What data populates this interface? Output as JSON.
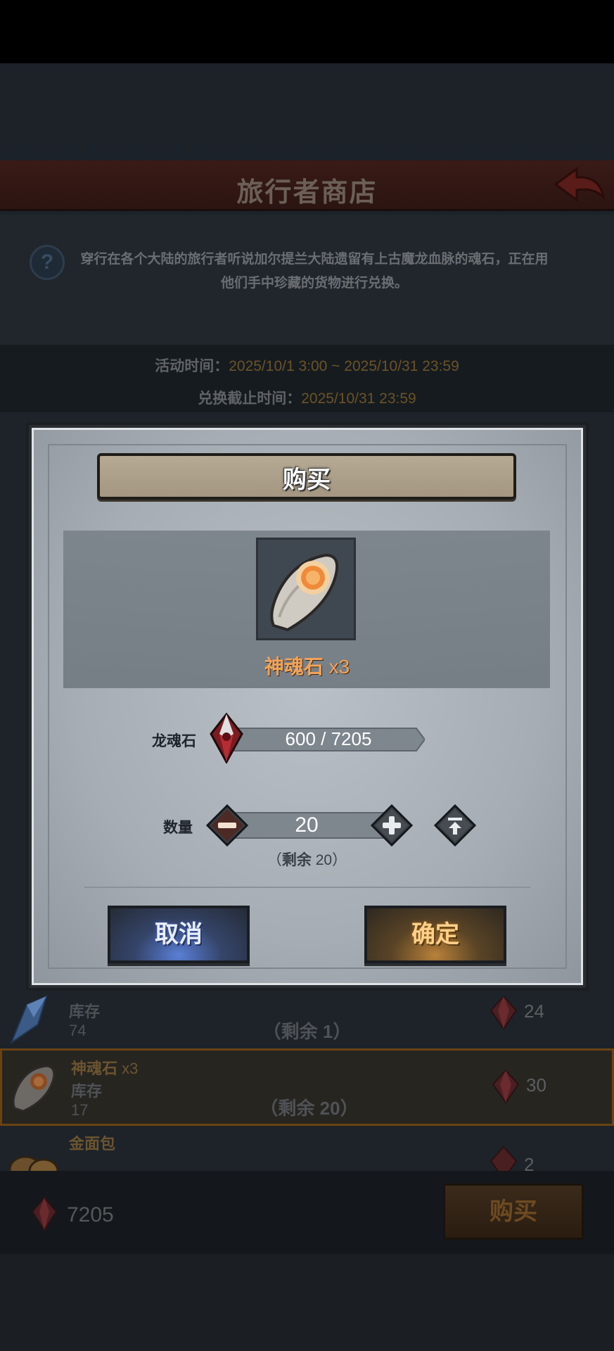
{
  "shop": {
    "title": "旅行者商店",
    "description": "穿行在各个大陆的旅行者听说加尔提兰大陆遗留有上古魔龙血脉的魂石，正在用他们手中珍藏的货物进行兑换。",
    "activity_time_label": "活动时间：",
    "activity_time_value": "2025/10/1 3:00 ~ 2025/10/31 23:59",
    "exchange_deadline_label": "兑换截止时间：",
    "exchange_deadline_value": "2025/10/31 23:59"
  },
  "list": {
    "items": [
      {
        "name": "",
        "stock_label": "库存",
        "stock": "74",
        "remain": "（剩余 1）",
        "price": "24"
      },
      {
        "name": "神魂石",
        "qty": "x3",
        "stock_label": "库存",
        "stock": "17",
        "remain": "（剩余 20）",
        "price": "30",
        "selected": true
      },
      {
        "name": "金面包",
        "stock_label": "",
        "stock": "",
        "remain": "",
        "price": "2"
      }
    ]
  },
  "bottom": {
    "balance": "7205",
    "buy_label": "购买"
  },
  "dialog": {
    "title": "购买",
    "item_name": "神魂石",
    "item_qty": "x3",
    "price_label": "龙魂石",
    "price_text": "600 / 7205",
    "quantity_label": "数量",
    "quantity_value": "20",
    "remain_prefix": "（",
    "remain_word": "剩余",
    "remain_value": " 20）",
    "cancel_label": "取消",
    "confirm_label": "确定"
  },
  "icons": {
    "currency": "red-crystal-icon",
    "item": "soul-stone-icon",
    "back": "back-arrow-icon",
    "help": "question-icon",
    "minus": "minus-icon",
    "plus": "plus-icon",
    "max": "max-icon"
  },
  "colors": {
    "item_name": "#f0a35a",
    "cancel_glow": "#5a7fd6",
    "confirm_glow": "#b9813a"
  }
}
